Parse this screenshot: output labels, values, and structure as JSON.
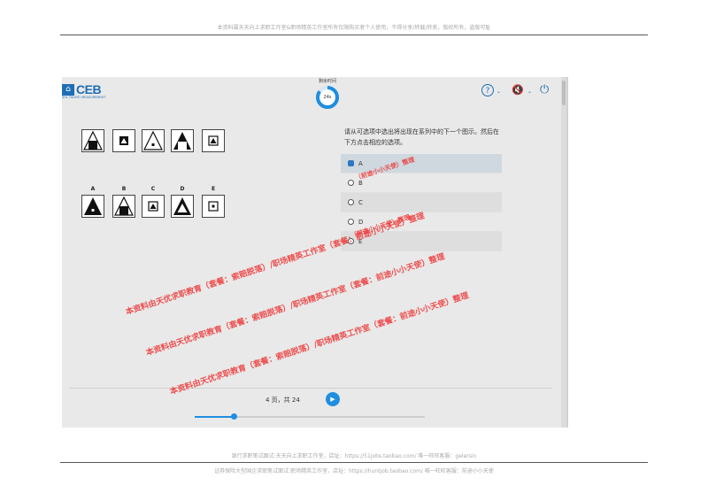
{
  "document": {
    "header_text": "本资料属天天向上求职工作室&职场精英工作室所有仅限购买者个人使用，不得分享/转载/转卖，版权所有，盗版可耻",
    "footer_line1": "银行求职笔试面试:天天向上求职工作室，店址：https://51jobs.taobao.com/ 唯一旺旺客服：gelersin",
    "footer_line2": "证券保险大型国企求职笔试面试:职场精英工作室，店址：https://huntjob.taobao.com/ 唯一旺旺客服：前途小小天使"
  },
  "app": {
    "logo_text": "CEB",
    "logo_sub": "SHL TALENT MEASUREMENT",
    "timer_label": "剩余时间",
    "timer_value": "24s",
    "timer_fraction": 0.85,
    "accent_color": "#1f6db7",
    "toolbar": {
      "help_icon": "?",
      "dropdown_caret": "⌄",
      "mute_icon": "🔇",
      "exit_icon": "⏻"
    }
  },
  "question": {
    "text": "请从可选项中选出将出现在系列中的下一个图示。然后在下方点击相应的选项。",
    "option_letters": [
      "A",
      "B",
      "C",
      "D",
      "E"
    ]
  },
  "choices": [
    {
      "label": "A",
      "selected": true
    },
    {
      "label": "B",
      "selected": false
    },
    {
      "label": "C",
      "selected": false
    },
    {
      "label": "D",
      "selected": false
    },
    {
      "label": "E",
      "selected": false
    }
  ],
  "pager": {
    "text": "4 页，共 24",
    "next_icon": "▶",
    "progress_fraction": 0.17
  },
  "watermarks": [
    "（前途小小天使）整理",
    "（前途小小天使）整理",
    "本资料由天优求职教育（套餐：索赔脱落）/职场精英工作室（套餐：前途小小天使）整理",
    "本资料由天优求职教育（套餐：索赔脱落）/职场精英工作室（套餐：前途小小天使）整理",
    "本资料由天优求职教育（套餐：索赔脱落）/职场精英工作室（套餐：前途小小天使）整理"
  ]
}
